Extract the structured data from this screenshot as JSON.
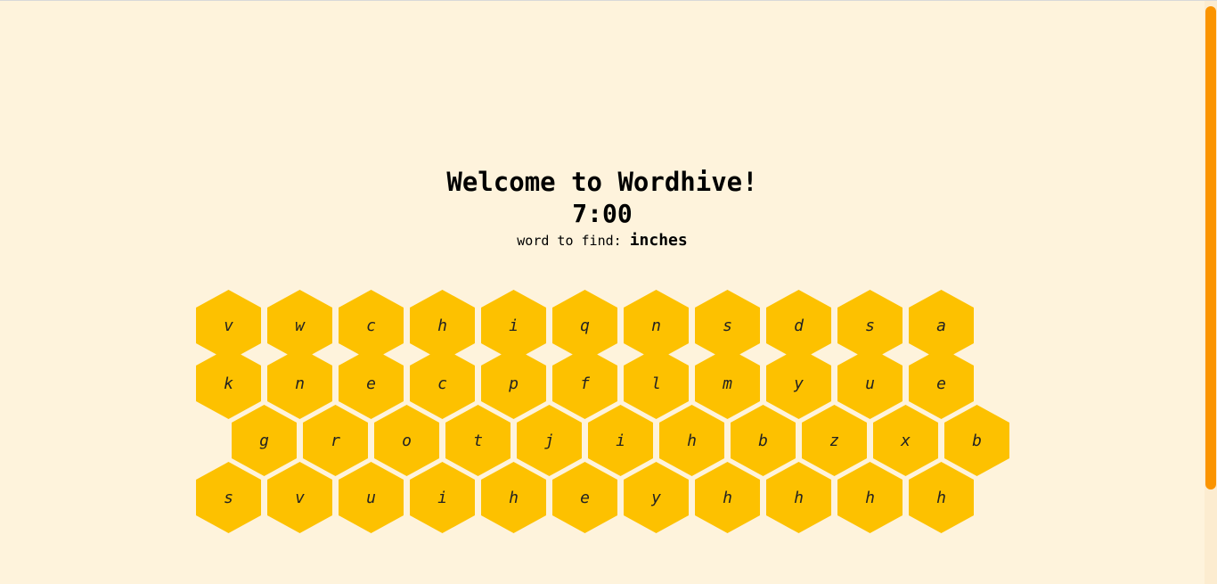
{
  "header": {
    "title": "Welcome to Wordhive!",
    "timer": "7:00",
    "find_label": "word to find:",
    "find_word": "inches"
  },
  "colors": {
    "background": "#fef3dc",
    "hex": "#fdc100",
    "scrollbar": "#fb9400"
  },
  "board": {
    "rows": [
      [
        "v",
        "w",
        "c",
        "h",
        "i",
        "q",
        "n",
        "s",
        "d",
        "s",
        "a"
      ],
      [
        "k",
        "n",
        "e",
        "c",
        "p",
        "f",
        "l",
        "m",
        "y",
        "u",
        "e"
      ],
      [
        "g",
        "r",
        "o",
        "t",
        "j",
        "i",
        "h",
        "b",
        "z",
        "x",
        "b"
      ],
      [
        "s",
        "v",
        "u",
        "i",
        "h",
        "e",
        "y",
        "h",
        "h",
        "h",
        "h"
      ]
    ]
  }
}
